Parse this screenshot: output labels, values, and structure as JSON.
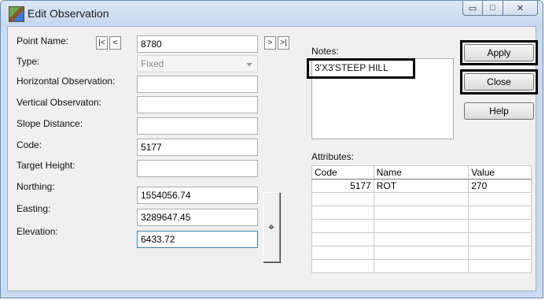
{
  "window": {
    "title": "Edit Observation",
    "minimize_glyph": "▭",
    "maximize_glyph": "□",
    "close_glyph": "✕"
  },
  "form": {
    "point_name_label": "Point Name:",
    "point_name_value": "8780",
    "nav_first": "|<",
    "nav_prev": "<",
    "nav_next": ">",
    "nav_last": ">|",
    "type_label": "Type:",
    "type_value": "Fixed",
    "horizontal_label": "Horizontal Observation:",
    "horizontal_value": "",
    "vertical_label": "Vertical Observaton:",
    "vertical_value": "",
    "slope_label": "Slope Distance:",
    "slope_value": "",
    "code_label": "Code:",
    "code_value": "5177",
    "target_label": "Target Height:",
    "target_value": "",
    "northing_label": "Northing:",
    "northing_value": "1554056.74",
    "easting_label": "Easting:",
    "easting_value": "3289647.45",
    "elevation_label": "Elevation:",
    "elevation_value": "6433.72",
    "locate_glyph": "⌖"
  },
  "notes": {
    "label": "Notes:",
    "value": "3'X3'STEEP HILL"
  },
  "buttons": {
    "apply": "Apply",
    "close": "Close",
    "help": "Help"
  },
  "attributes": {
    "label": "Attributes:",
    "columns": [
      "Code",
      "Name",
      "Value"
    ],
    "rows": [
      [
        "5177",
        "ROT",
        "270"
      ]
    ]
  }
}
